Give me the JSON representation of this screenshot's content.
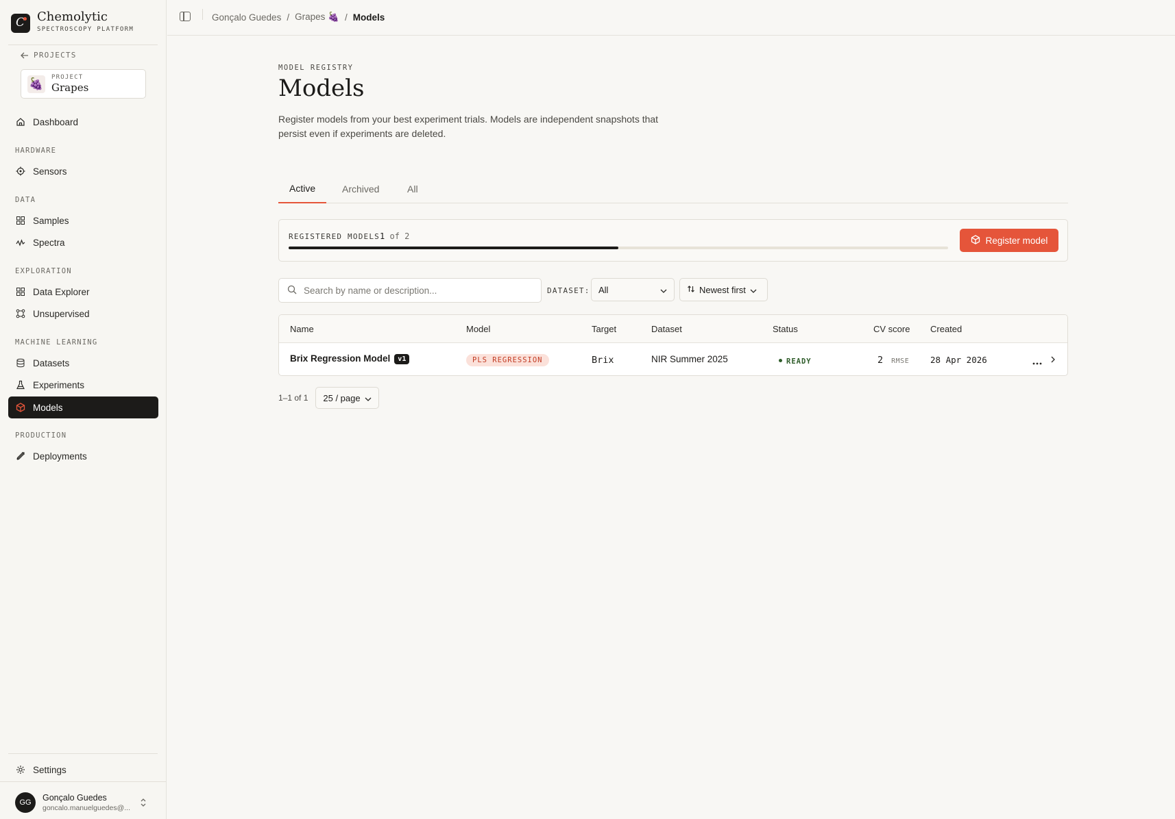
{
  "brand": {
    "name": "Chemolytic",
    "subtitle": "SPECTROSCOPY PLATFORM"
  },
  "sidebar": {
    "back_label": "PROJECTS",
    "project": {
      "label": "PROJECT",
      "name": "Grapes",
      "icon": "grapes-emoji"
    },
    "items": [
      {
        "label": "Dashboard",
        "icon": "home-icon"
      },
      {
        "section": "HARDWARE"
      },
      {
        "label": "Sensors",
        "icon": "sensor-icon"
      },
      {
        "section": "DATA"
      },
      {
        "label": "Samples",
        "icon": "grid-icon"
      },
      {
        "label": "Spectra",
        "icon": "wave-icon"
      },
      {
        "section": "EXPLORATION"
      },
      {
        "label": "Data Explorer",
        "icon": "grid-icon"
      },
      {
        "label": "Unsupervised",
        "icon": "nodes-icon"
      },
      {
        "section": "MACHINE LEARNING"
      },
      {
        "label": "Datasets",
        "icon": "database-icon"
      },
      {
        "label": "Experiments",
        "icon": "flask-icon"
      },
      {
        "label": "Models",
        "icon": "cube-icon",
        "active": true
      },
      {
        "section": "PRODUCTION"
      },
      {
        "label": "Deployments",
        "icon": "rocket-icon"
      }
    ],
    "settings_label": "Settings",
    "user": {
      "initials": "GG",
      "name": "Gonçalo Guedes",
      "email": "goncalo.manuelguedes@..."
    }
  },
  "breadcrumb": {
    "parts": [
      "Gonçalo Guedes",
      "Grapes 🍇",
      "Models"
    ],
    "separator": "/"
  },
  "page": {
    "eyebrow": "MODEL REGISTRY",
    "title": "Models",
    "description": "Register models from your best experiment trials. Models are independent snapshots that persist even if experiments are deleted."
  },
  "tabs": [
    "Active",
    "Archived",
    "All"
  ],
  "active_tab": "Active",
  "registry": {
    "label": "REGISTERED MODELS",
    "count": "1",
    "of_text": "of 2",
    "usage_fraction": 0.5,
    "register_label": "Register model"
  },
  "filters": {
    "search_placeholder": "Search by name or description...",
    "dataset_label": "DATASET:",
    "dataset_value": "All",
    "sort_value": "Newest first"
  },
  "table": {
    "columns": [
      "Name",
      "Model",
      "Target",
      "Dataset",
      "Status",
      "CV score",
      "Created"
    ],
    "rows": [
      {
        "name": "Brix Regression Model",
        "version": "v1",
        "model": "PLS REGRESSION",
        "target": "Brix",
        "dataset": "NIR Summer 2025",
        "status": "READY",
        "cv_score": "2",
        "cv_metric": "RMSE",
        "created": "28 Apr 2026"
      }
    ]
  },
  "pagination": {
    "range": "1–1 of 1",
    "page_size": "25 / page"
  },
  "colors": {
    "accent": "#e5553a",
    "dark": "#1c1b19",
    "ready": "#2f5d2a"
  }
}
